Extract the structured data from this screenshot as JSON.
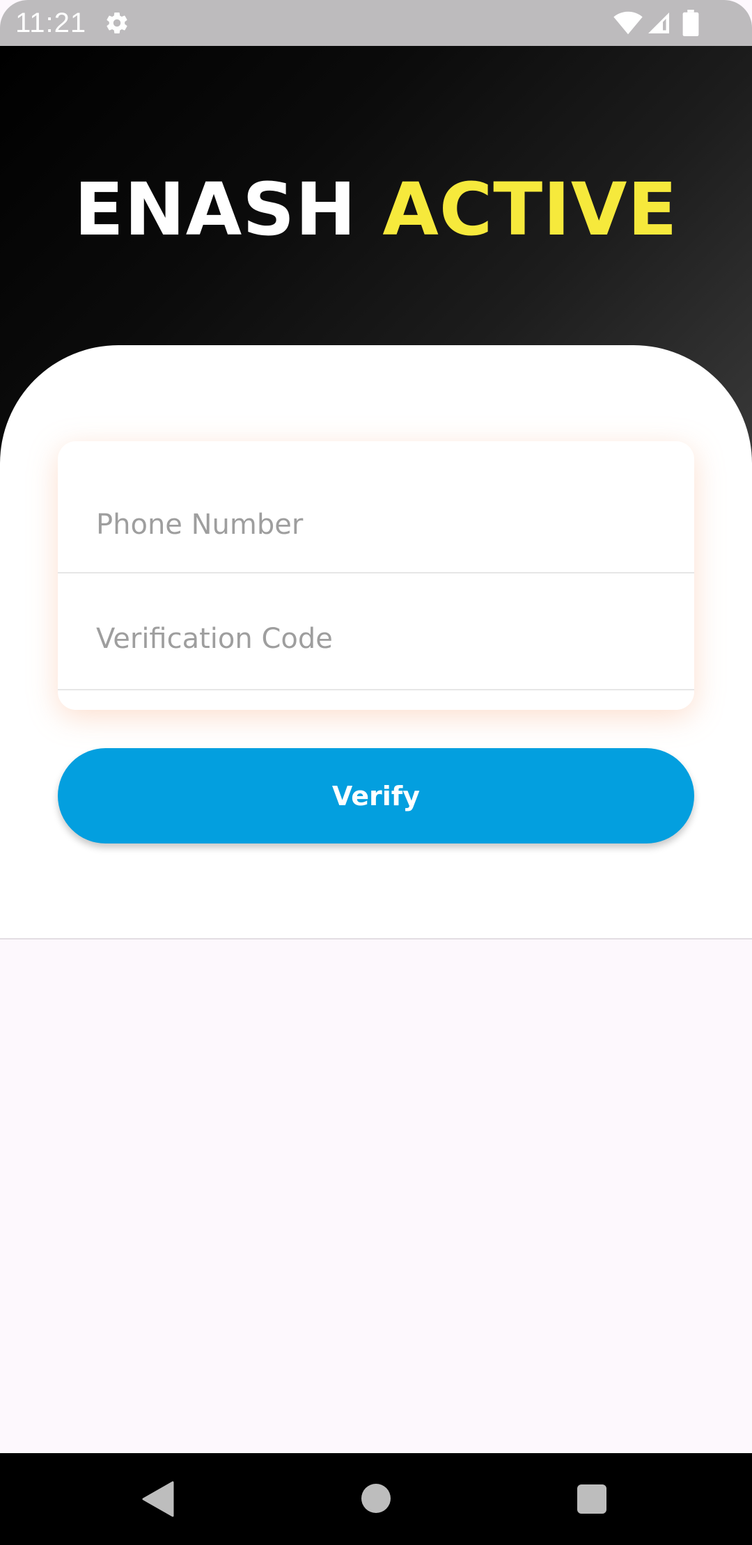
{
  "status_bar": {
    "time": "11:21",
    "icons": [
      "gear-icon",
      "wifi-icon",
      "signal-icon",
      "battery-icon"
    ]
  },
  "header": {
    "title_part1": "ENASH",
    "title_part2": "ACTIVE"
  },
  "form": {
    "phone_placeholder": "Phone Number",
    "phone_value": "",
    "code_placeholder": "Verification Code",
    "code_value": ""
  },
  "actions": {
    "verify_label": "Verify"
  },
  "nav_bar": {
    "icons": [
      "back-icon",
      "home-icon",
      "recents-icon"
    ]
  },
  "colors": {
    "accent_yellow": "#f6e93c",
    "button_blue": "#039fdf",
    "header_dark": "#000000",
    "background": "#fdf8fd"
  }
}
